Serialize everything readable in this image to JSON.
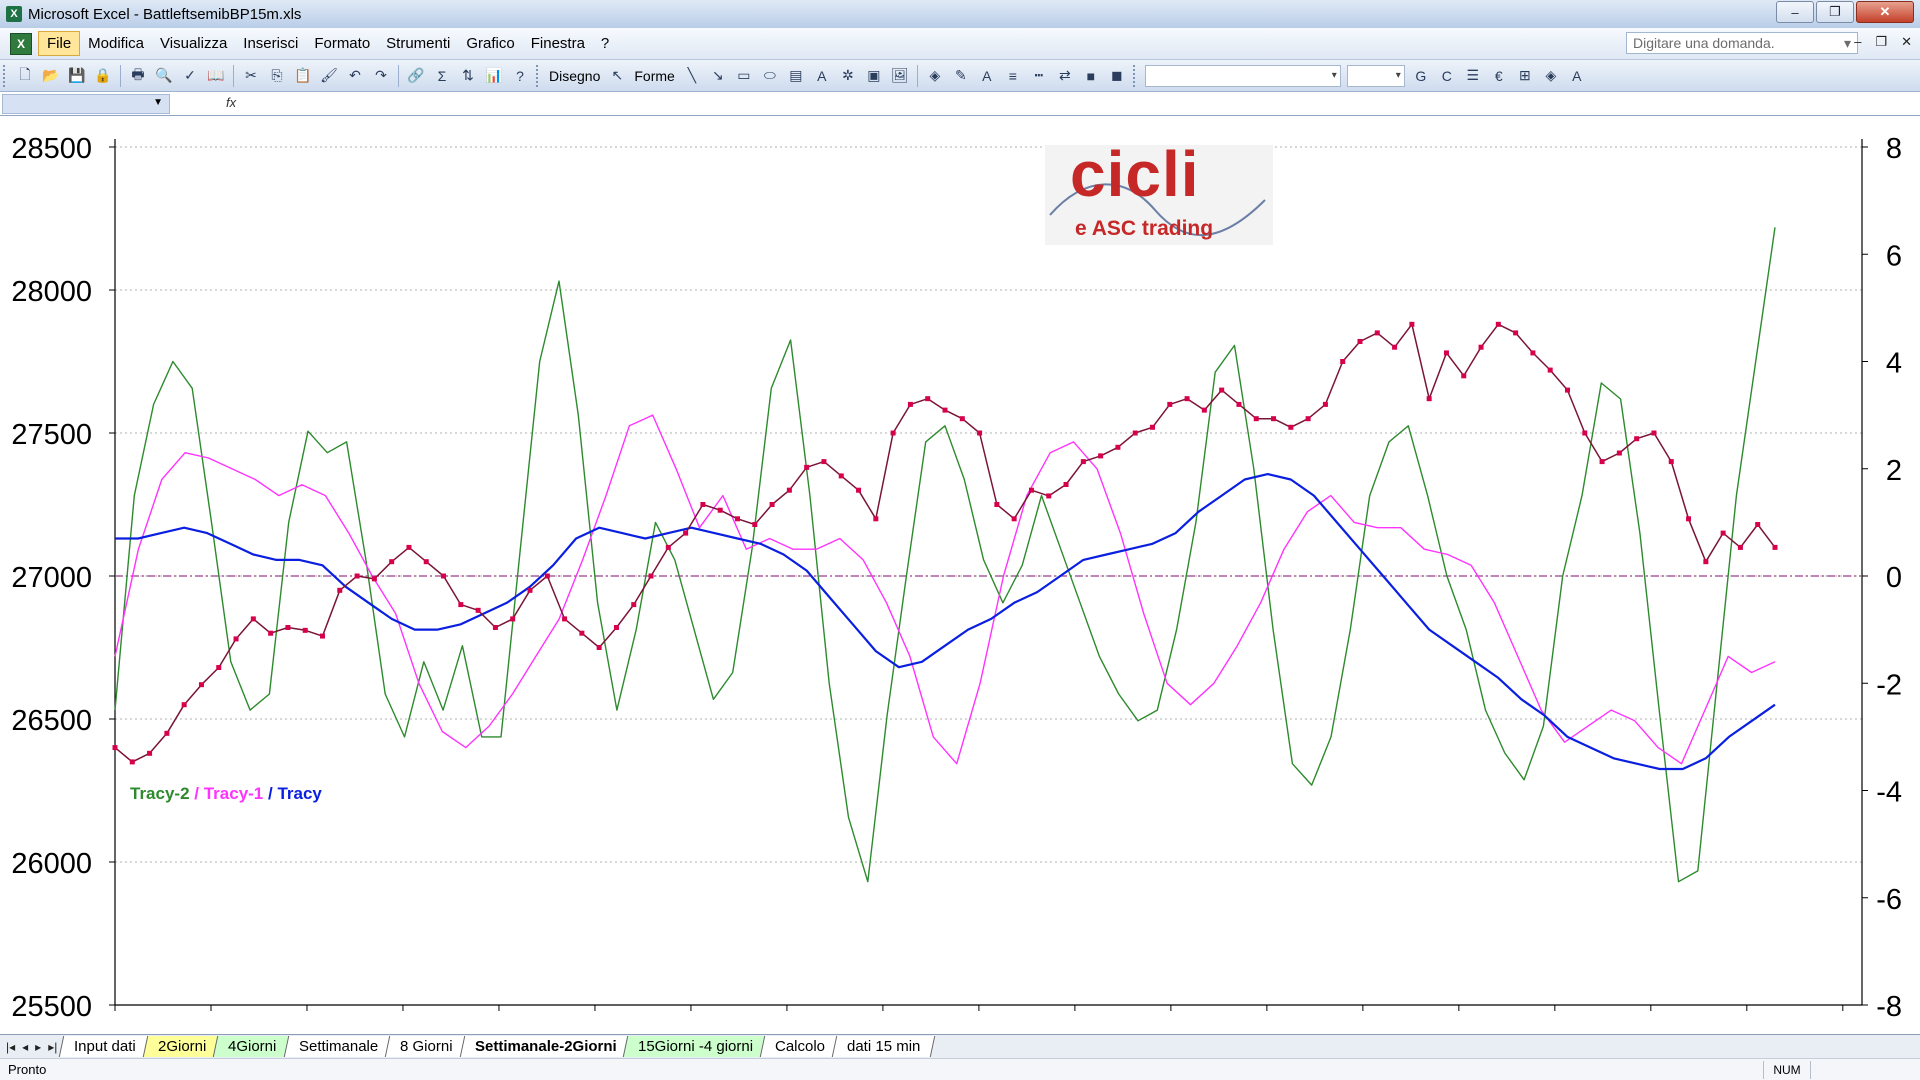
{
  "window": {
    "title": "Microsoft Excel - BattleftsemibBP15m.xls",
    "minimize": "–",
    "restore": "❐",
    "close": "✕"
  },
  "menu": {
    "items": [
      "File",
      "Modifica",
      "Visualizza",
      "Inserisci",
      "Formato",
      "Strumenti",
      "Grafico",
      "Finestra",
      "?"
    ],
    "help_placeholder": "Digitare una domanda.",
    "doc_minimize": "–",
    "doc_restore": "❐",
    "doc_close": "✕"
  },
  "toolbar": {
    "disegno_label": "Disegno",
    "forme_label": "Forme",
    "bold_label": "G",
    "italic_label": "C",
    "euro_label": "€"
  },
  "formula": {
    "fx_label": "fx"
  },
  "logo": {
    "main": "cicli",
    "sub": "e ASC trading"
  },
  "legend": {
    "tracy2": "Tracy-2",
    "sep1": " / ",
    "tracy1": "Tracy-1",
    "sep2": " / ",
    "tracy": "Tracy"
  },
  "sheets": {
    "tabs": [
      {
        "label": "Input dati",
        "color": "white",
        "active": false
      },
      {
        "label": "2Giorni",
        "color": "yellow",
        "active": false
      },
      {
        "label": "4Giorni",
        "color": "green",
        "active": false
      },
      {
        "label": "Settimanale",
        "color": "white",
        "active": false
      },
      {
        "label": "8 Giorni",
        "color": "white",
        "active": false
      },
      {
        "label": "Settimanale-2Giorni",
        "color": "white",
        "active": true
      },
      {
        "label": "15Giorni -4 giorni",
        "color": "green",
        "active": false
      },
      {
        "label": "Calcolo",
        "color": "white",
        "active": false
      },
      {
        "label": "dati 15 min",
        "color": "white",
        "active": false
      }
    ]
  },
  "status": {
    "text": "Pronto",
    "num": "NUM"
  },
  "colors": {
    "price": "#7a1535",
    "price_marker": "#d6004c",
    "tracy": "#0a1fe0",
    "tracy1": "#ff33ff",
    "tracy2": "#2d8a2d",
    "zero_line": "#9b3d8a"
  },
  "chart_data": {
    "type": "line",
    "left_axis": {
      "min": 25500,
      "max": 28500,
      "ticks": [
        25500,
        26000,
        26500,
        27000,
        27500,
        28000,
        28500
      ]
    },
    "right_axis": {
      "min": -8,
      "max": 8,
      "ticks": [
        -8,
        -6,
        -4,
        -2,
        0,
        2,
        4,
        6,
        8
      ]
    },
    "x_count": 100,
    "series": [
      {
        "name": "Tracy-2",
        "axis": "right",
        "values": [
          -2.5,
          1.5,
          3.2,
          4.0,
          3.5,
          1.0,
          -1.6,
          -2.5,
          -2.2,
          1.0,
          2.7,
          2.3,
          2.5,
          0.3,
          -2.2,
          -3.0,
          -1.6,
          -2.5,
          -1.3,
          -3.0,
          -3.0,
          0.5,
          4.0,
          5.5,
          3.0,
          -0.5,
          -2.5,
          -1.0,
          1.0,
          0.3,
          -1.0,
          -2.3,
          -1.8,
          0.5,
          3.5,
          4.4,
          1.5,
          -2.0,
          -4.5,
          -5.7,
          -2.6,
          0.0,
          2.5,
          2.8,
          1.8,
          0.3,
          -0.5,
          0.2,
          1.5,
          0.5,
          -0.5,
          -1.5,
          -2.2,
          -2.7,
          -2.5,
          -1.0,
          1.0,
          3.8,
          4.3,
          2.0,
          -1.0,
          -3.5,
          -3.9,
          -3.0,
          -1.0,
          1.5,
          2.5,
          2.8,
          1.5,
          0.0,
          -1.0,
          -2.5,
          -3.3,
          -3.8,
          -2.8,
          0.0,
          1.5,
          3.6,
          3.3,
          0.8,
          -2.5,
          -5.7,
          -5.5,
          -2.0,
          1.5,
          4.0,
          6.5
        ],
        "x_start": 0
      },
      {
        "name": "Tracy-1",
        "axis": "right",
        "values": [
          -1.5,
          0.5,
          1.8,
          2.3,
          2.2,
          2.0,
          1.8,
          1.5,
          1.7,
          1.5,
          0.8,
          0.0,
          -0.7,
          -2.0,
          -2.9,
          -3.2,
          -2.8,
          -2.2,
          -1.5,
          -0.8,
          0.3,
          1.5,
          2.8,
          3.0,
          2.0,
          0.9,
          1.5,
          0.5,
          0.7,
          0.5,
          0.5,
          0.7,
          0.3,
          -0.5,
          -1.5,
          -3.0,
          -3.5,
          -2.0,
          0.0,
          1.5,
          2.3,
          2.5,
          2.0,
          0.8,
          -0.7,
          -2.0,
          -2.4,
          -2.0,
          -1.3,
          -0.5,
          0.5,
          1.2,
          1.5,
          1.0,
          0.9,
          0.9,
          0.5,
          0.4,
          0.2,
          -0.5,
          -1.5,
          -2.5,
          -3.1,
          -2.8,
          -2.5,
          -2.7,
          -3.2,
          -3.5,
          -2.5,
          -1.5,
          -1.8,
          -1.6
        ],
        "x_start": 0
      },
      {
        "name": "Tracy",
        "axis": "right",
        "values": [
          0.7,
          0.7,
          0.8,
          0.9,
          0.8,
          0.6,
          0.4,
          0.3,
          0.3,
          0.2,
          -0.2,
          -0.5,
          -0.8,
          -1.0,
          -1.0,
          -0.9,
          -0.7,
          -0.5,
          -0.2,
          0.2,
          0.7,
          0.9,
          0.8,
          0.7,
          0.8,
          0.9,
          0.8,
          0.7,
          0.6,
          0.4,
          0.1,
          -0.4,
          -0.9,
          -1.4,
          -1.7,
          -1.6,
          -1.3,
          -1.0,
          -0.8,
          -0.5,
          -0.3,
          0.0,
          0.3,
          0.4,
          0.5,
          0.6,
          0.8,
          1.2,
          1.5,
          1.8,
          1.9,
          1.8,
          1.5,
          1.0,
          0.5,
          0.0,
          -0.5,
          -1.0,
          -1.3,
          -1.6,
          -1.9,
          -2.3,
          -2.6,
          -3.0,
          -3.2,
          -3.4,
          -3.5,
          -3.6,
          -3.6,
          -3.4,
          -3.0,
          -2.7,
          -2.4
        ],
        "x_start": 0
      },
      {
        "name": "Prezzo",
        "axis": "left",
        "values": [
          26400,
          26350,
          26380,
          26450,
          26550,
          26620,
          26680,
          26780,
          26850,
          26800,
          26820,
          26810,
          26790,
          26950,
          27000,
          26990,
          27050,
          27100,
          27050,
          27000,
          26900,
          26880,
          26820,
          26850,
          26950,
          27000,
          26850,
          26800,
          26750,
          26820,
          26900,
          27000,
          27100,
          27150,
          27250,
          27230,
          27200,
          27180,
          27250,
          27300,
          27380,
          27400,
          27350,
          27300,
          27200,
          27500,
          27600,
          27620,
          27580,
          27550,
          27500,
          27250,
          27200,
          27300,
          27280,
          27320,
          27400,
          27420,
          27450,
          27500,
          27520,
          27600,
          27620,
          27580,
          27650,
          27600,
          27550,
          27550,
          27520,
          27550,
          27600,
          27750,
          27820,
          27850,
          27800,
          27880,
          27620,
          27780,
          27700,
          27800,
          27880,
          27850,
          27780,
          27720,
          27650,
          27500,
          27400,
          27430,
          27480,
          27500,
          27400,
          27200,
          27050,
          27150,
          27100,
          27180,
          27100
        ]
      }
    ]
  }
}
